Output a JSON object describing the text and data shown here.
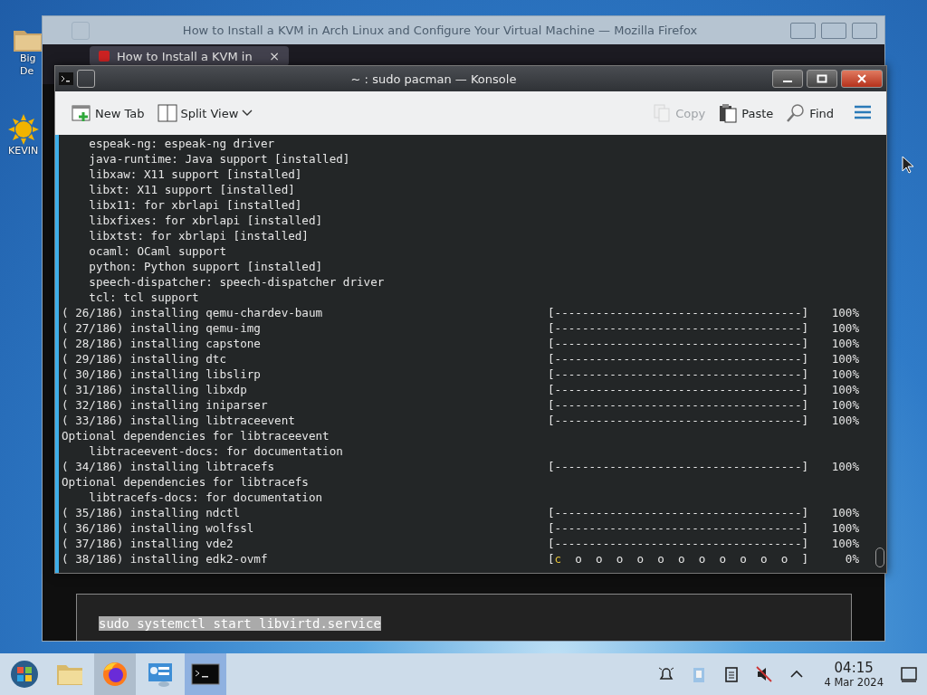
{
  "desktop_icons": [
    {
      "label": "Big",
      "label2": "De",
      "kind": "folder"
    },
    {
      "label": "KEVIN",
      "kind": "sun"
    }
  ],
  "browser": {
    "title": "How to Install a KVM in Arch Linux and Configure Your Virtual Machine — Mozilla Firefox",
    "tab": {
      "label": "How to Install a KVM in",
      "close": "×"
    },
    "code": "sudo systemctl start libvirtd.service"
  },
  "konsole": {
    "title": "~ : sudo pacman — Konsole",
    "toolbar": [
      {
        "label": "New Tab",
        "kind": "newtab",
        "disabled": false
      },
      {
        "label": "Split View",
        "kind": "split",
        "disabled": false
      },
      {
        "label": "Copy",
        "kind": "copy",
        "disabled": true
      },
      {
        "label": "Paste",
        "kind": "paste",
        "disabled": false
      },
      {
        "label": "Find",
        "kind": "find",
        "disabled": false
      }
    ],
    "lines": [
      {
        "kind": "text",
        "indent": true,
        "text": "espeak-ng: espeak-ng driver"
      },
      {
        "kind": "text",
        "indent": true,
        "text": "java-runtime: Java support [installed]"
      },
      {
        "kind": "text",
        "indent": true,
        "text": "libxaw: X11 support [installed]"
      },
      {
        "kind": "text",
        "indent": true,
        "text": "libxt: X11 support [installed]"
      },
      {
        "kind": "text",
        "indent": true,
        "text": "libx11: for xbrlapi [installed]"
      },
      {
        "kind": "text",
        "indent": true,
        "text": "libxfixes: for xbrlapi [installed]"
      },
      {
        "kind": "text",
        "indent": true,
        "text": "libxtst: for xbrlapi [installed]"
      },
      {
        "kind": "text",
        "indent": true,
        "text": "ocaml: OCaml support"
      },
      {
        "kind": "text",
        "indent": true,
        "text": "python: Python support [installed]"
      },
      {
        "kind": "text",
        "indent": true,
        "text": "speech-dispatcher: speech-dispatcher driver"
      },
      {
        "kind": "text",
        "indent": true,
        "text": "tcl: tcl support"
      },
      {
        "kind": "progress",
        "text": "( 26/186) installing qemu-chardev-baum",
        "bar": "[------------------------------------]",
        "percent": "100%"
      },
      {
        "kind": "progress",
        "text": "( 27/186) installing qemu-img",
        "bar": "[------------------------------------]",
        "percent": "100%"
      },
      {
        "kind": "progress",
        "text": "( 28/186) installing capstone",
        "bar": "[------------------------------------]",
        "percent": "100%"
      },
      {
        "kind": "progress",
        "text": "( 29/186) installing dtc",
        "bar": "[------------------------------------]",
        "percent": "100%"
      },
      {
        "kind": "progress",
        "text": "( 30/186) installing libslirp",
        "bar": "[------------------------------------]",
        "percent": "100%"
      },
      {
        "kind": "progress",
        "text": "( 31/186) installing libxdp",
        "bar": "[------------------------------------]",
        "percent": "100%"
      },
      {
        "kind": "progress",
        "text": "( 32/186) installing iniparser",
        "bar": "[------------------------------------]",
        "percent": "100%"
      },
      {
        "kind": "progress",
        "text": "( 33/186) installing libtraceevent",
        "bar": "[------------------------------------]",
        "percent": "100%"
      },
      {
        "kind": "text",
        "indent": false,
        "text": "Optional dependencies for libtraceevent"
      },
      {
        "kind": "text",
        "indent": true,
        "text": "libtraceevent-docs: for documentation"
      },
      {
        "kind": "progress",
        "text": "( 34/186) installing libtracefs",
        "bar": "[------------------------------------]",
        "percent": "100%"
      },
      {
        "kind": "text",
        "indent": false,
        "text": "Optional dependencies for libtracefs"
      },
      {
        "kind": "text",
        "indent": true,
        "text": "libtracefs-docs: for documentation"
      },
      {
        "kind": "progress",
        "text": "( 35/186) installing ndctl",
        "bar": "[------------------------------------]",
        "percent": "100%"
      },
      {
        "kind": "progress",
        "text": "( 36/186) installing wolfssl",
        "bar": "[------------------------------------]",
        "percent": "100%"
      },
      {
        "kind": "progress",
        "text": "( 37/186) installing vde2",
        "bar": "[------------------------------------]",
        "percent": "100%"
      },
      {
        "kind": "pacman",
        "text": "( 38/186) installing edk2-ovmf",
        "open": "[",
        "head": "c",
        "rest": "  o  o  o  o  o  o  o  o  o  o  o  ]",
        "percent": "0%"
      }
    ]
  },
  "taskbar": {
    "items": [
      {
        "kind": "start",
        "selected": false,
        "hovered": false
      },
      {
        "kind": "folder",
        "selected": false,
        "hovered": false
      },
      {
        "kind": "firefox",
        "selected": false,
        "hovered": true
      },
      {
        "kind": "settings",
        "selected": false,
        "hovered": false
      },
      {
        "kind": "terminal",
        "selected": true,
        "hovered": false
      }
    ],
    "tray": [
      {
        "kind": "bell"
      },
      {
        "kind": "clipboard"
      },
      {
        "kind": "notes"
      },
      {
        "kind": "mute"
      },
      {
        "kind": "up"
      }
    ],
    "time": "04:15",
    "date": "4 Mar 2024"
  }
}
